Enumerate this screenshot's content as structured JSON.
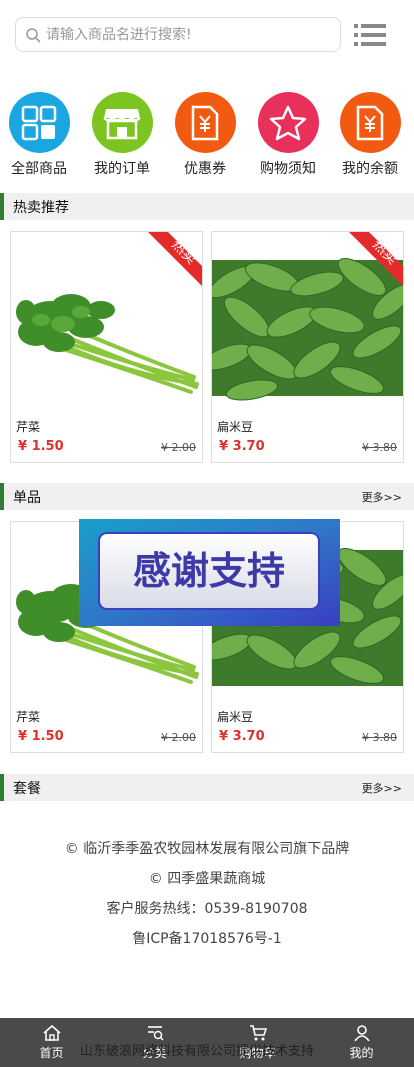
{
  "search": {
    "placeholder": "请输入商品名进行搜索!"
  },
  "icons": {
    "search": "search-icon",
    "menu": "list-menu-icon"
  },
  "categories": [
    {
      "label": "全部商品",
      "icon": "grid-icon",
      "color": "#1aa6e0"
    },
    {
      "label": "我的订单",
      "icon": "store-icon",
      "color": "#7cc520"
    },
    {
      "label": "优惠券",
      "icon": "coupon-yen-icon",
      "color": "#f25a12"
    },
    {
      "label": "购物须知",
      "icon": "star-icon",
      "color": "#e8315a"
    },
    {
      "label": "我的余额",
      "icon": "balance-yen-icon",
      "color": "#f25a12"
    }
  ],
  "sections": {
    "hot": {
      "title": "热卖推荐"
    },
    "single": {
      "title": "单品",
      "more": "更多>>"
    },
    "combo": {
      "title": "套餐",
      "more": "更多>>"
    }
  },
  "badge": {
    "text": "热卖",
    "color": "#e32b2b"
  },
  "hot_products": [
    {
      "name": "芹菜",
      "price": "¥ 1.50",
      "old_price": "¥ 2.00",
      "image": "celery"
    },
    {
      "name": "扁米豆",
      "price": "¥ 3.70",
      "old_price": "¥ 3.80",
      "image": "green-beans"
    }
  ],
  "single_products": [
    {
      "name": "芹菜",
      "price": "¥ 1.50",
      "old_price": "¥ 2.00",
      "image": "celery"
    },
    {
      "name": "扁米豆",
      "price": "¥ 3.70",
      "old_price": "¥ 3.80",
      "image": "green-beans"
    }
  ],
  "overlay": {
    "text": "感谢支持"
  },
  "footer": {
    "brand_line": "© 临沂季季盈农牧园林发展有限公司旗下品牌",
    "store_line": "© 四季盛果蔬商城",
    "hotline": "客户服务热线：0539-8190708",
    "icp": "鲁ICP备17018576号-1"
  },
  "bottom_nav": {
    "items": [
      {
        "label": "首页",
        "icon": "home-icon"
      },
      {
        "label": "分类",
        "icon": "category-search-icon"
      },
      {
        "label": "购物车",
        "icon": "cart-icon"
      },
      {
        "label": "我的",
        "icon": "user-icon"
      }
    ],
    "support_text": "山东破浪网络科技有限公司提供技术支持"
  }
}
